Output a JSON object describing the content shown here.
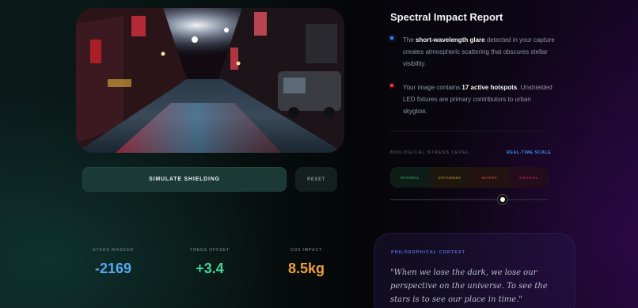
{
  "photo": {
    "alt": "Rainy neon-lit alley at night"
  },
  "controls": {
    "simulate_label": "SIMULATE SHIELDING",
    "reset_label": "RESET"
  },
  "stats": [
    {
      "label": "STARS MASKED",
      "value": "-2169",
      "color": "#58a6f0"
    },
    {
      "label": "TREES OFFSET",
      "value": "+3.4",
      "color": "#44d49a"
    },
    {
      "label": "CO2 IMPACT",
      "value": "8.5kg",
      "color": "#f0a030"
    }
  ],
  "report": {
    "title": "Spectral Impact Report",
    "bullets": [
      {
        "pre": "The ",
        "bold": "short-wavelength glare",
        "post": " detected in your capture creates atmospheric scattering that obscures stellar visibility.",
        "dot_color": "#3a86ff"
      },
      {
        "pre": "Your image contains ",
        "bold": "17 active hotspots",
        "post": ". Unshielded LED fixtures are primary contributors to urban skyglow.",
        "dot_color": "#ff3a3a"
      }
    ]
  },
  "stress": {
    "title": "BIOLOGICAL STRESS LEVEL",
    "scale_label": "REAL-TIME SCALE",
    "levels": [
      "NATURAL",
      "DISTURBED",
      "SEVERE",
      "CRITICAL"
    ],
    "value_fraction": 0.71
  },
  "philosophy": {
    "label": "PHILOSOPHICAL CONTEXT",
    "quote": "\"When we lose the dark, we lose our perspective on the universe. To see the stars is to see our place in time.\""
  },
  "colors": {
    "accent_blue": "#3a8cf0",
    "accent_green": "#44d49a",
    "accent_orange": "#f0a030",
    "alert_red": "#ff3a3a"
  }
}
